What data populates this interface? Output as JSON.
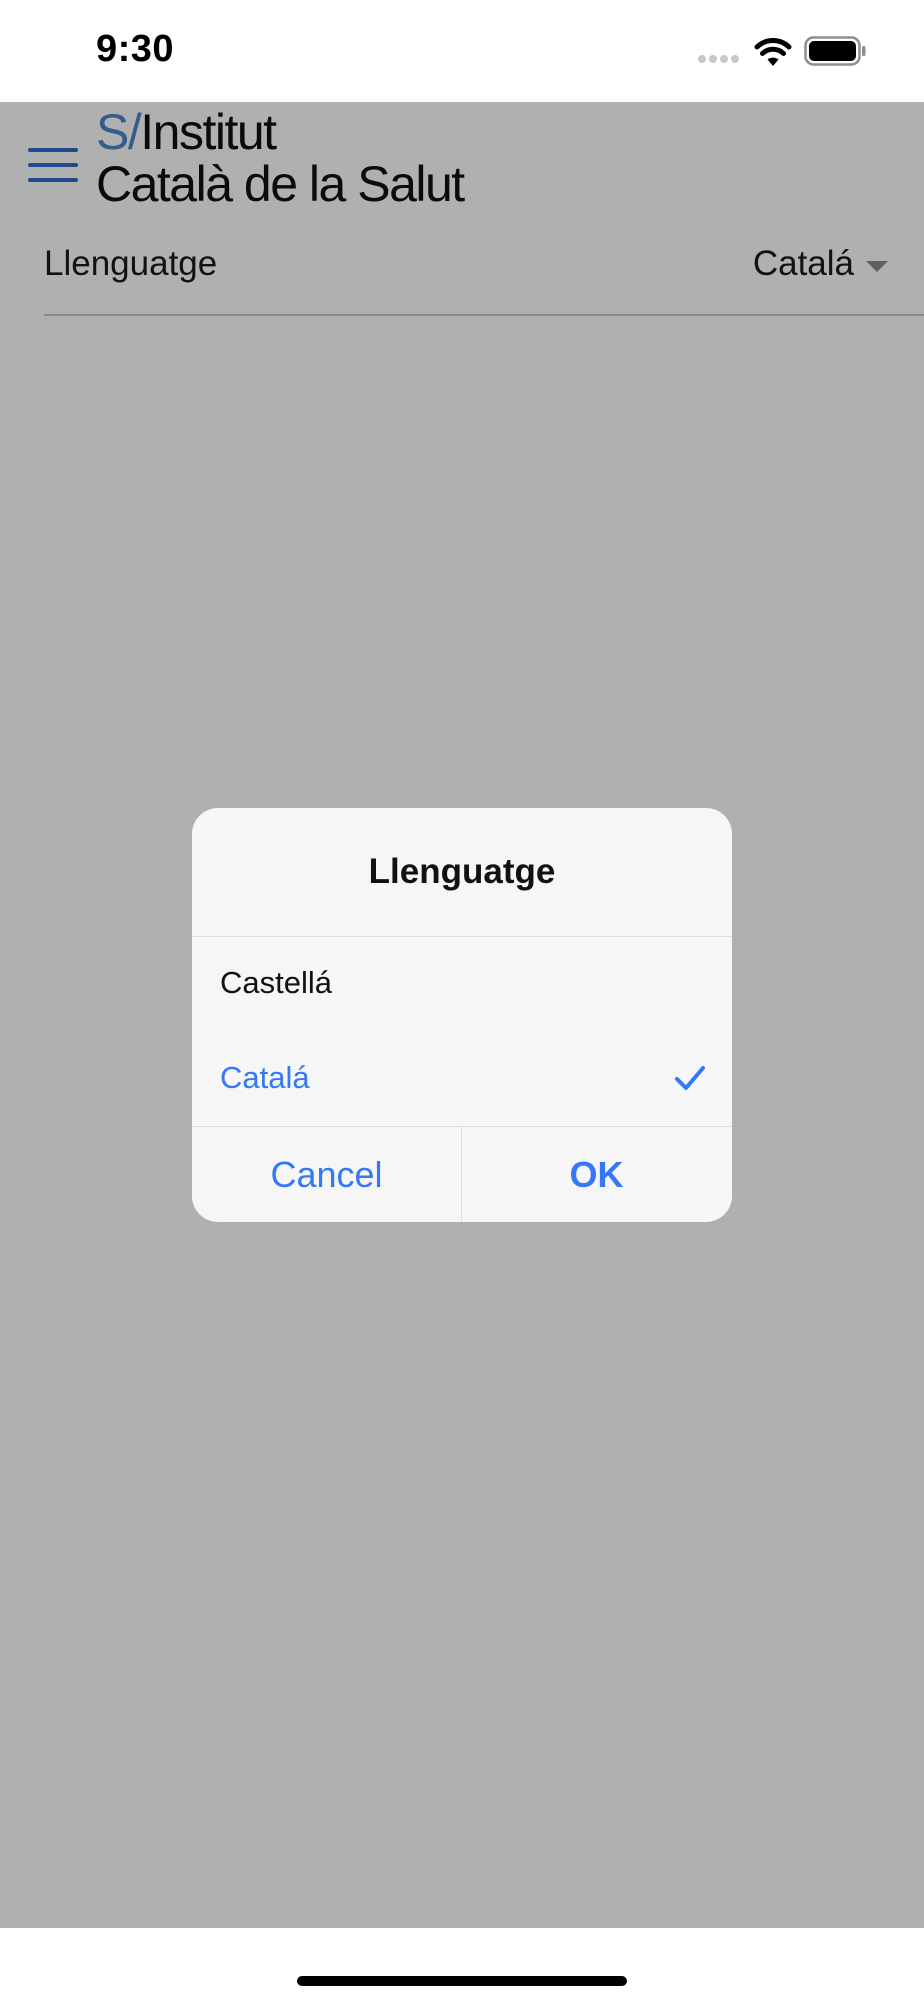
{
  "status_bar": {
    "time": "9:30",
    "signal_icon": "cellular-signal-icon",
    "wifi_icon": "wifi-icon",
    "battery_icon": "battery-icon"
  },
  "header": {
    "menu_icon": "hamburger-menu-icon",
    "logo_mark": "S/",
    "logo_line1": "Institut",
    "logo_line2": "Català de la Salut"
  },
  "settings": {
    "language_label": "Llenguatge",
    "language_value": "Catalá"
  },
  "dialog": {
    "title": "Llenguatge",
    "options": [
      {
        "label": "Castellá",
        "selected": false
      },
      {
        "label": "Catalá",
        "selected": true
      }
    ],
    "cancel_label": "Cancel",
    "ok_label": "OK"
  },
  "colors": {
    "accent": "#3478f6",
    "logo_mark": "#4a88c8",
    "menu_icon": "#2f6cc8",
    "dialog_background": "#f6f6f6",
    "scrim": "rgba(0,0,0,0.31)"
  }
}
